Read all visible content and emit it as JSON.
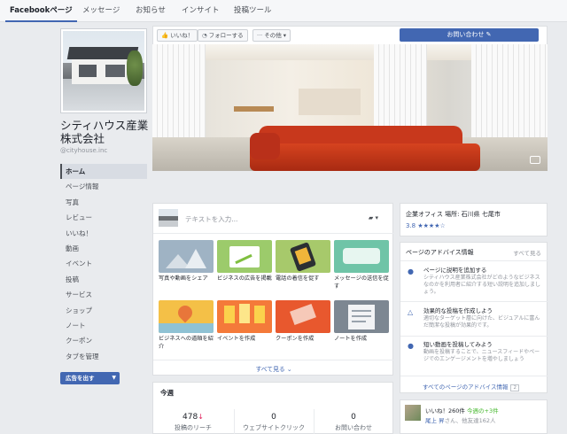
{
  "topbar": {
    "tabs": [
      "Facebookページ",
      "メッセージ",
      "お知らせ",
      "インサイト",
      "投稿ツール"
    ]
  },
  "page": {
    "name": "シティハウス産業株式会社",
    "handle": "@cityhouse.inc"
  },
  "leftnav": {
    "items": [
      "ホーム",
      "ページ情報",
      "写真",
      "レビュー",
      "いいね！",
      "動画",
      "イベント",
      "投稿",
      "サービス",
      "ショップ",
      "ノート",
      "クーポン",
      "タブを管理"
    ],
    "promote_label": "広告を出す"
  },
  "actions": {
    "like": "いいね！",
    "follow": "フォローする",
    "more": "その他",
    "contact": "お問い合わせ"
  },
  "composer": {
    "placeholder": "テキストを入力...",
    "tiles": [
      {
        "label": "写真や動画をシェア"
      },
      {
        "label": "ビジネスの広告を掲載"
      },
      {
        "label": "電話の着信を促す"
      },
      {
        "label": "メッセージの送信を促す"
      },
      {
        "label": "ビジネスへの道順を紹介"
      },
      {
        "label": "イベントを作成"
      },
      {
        "label": "クーポンを作成"
      },
      {
        "label": "ノートを作成"
      }
    ],
    "see_all": "すべて見る"
  },
  "week": {
    "title": "今週",
    "stats": [
      {
        "value": "478",
        "label": "投稿のリーチ",
        "trend": "↓"
      },
      {
        "value": "0",
        "label": "ウェブサイトクリック"
      },
      {
        "value": "0",
        "label": "お問い合わせ"
      }
    ]
  },
  "info": {
    "location": "企業オフィス 場所: 石川県 七尾市",
    "rating": "3.8",
    "stars": "★★★★☆"
  },
  "advice": {
    "title": "ページのアドバイス情報",
    "see_all": "すべて見る",
    "items": [
      {
        "title": "ページに説明を追加する",
        "text": "シティハウス産業株式会社がどのようなビジネスなのかを利用者に紹介する短い説明を追加しましょう。"
      },
      {
        "title": "効果的な投稿を作成しよう",
        "text": "適切なターゲット層に向けた、ビジュアルに富んだ簡潔な投稿が効果的です。"
      },
      {
        "title": "短い動画を投稿してみよう",
        "text": "動画を投稿することで、ニュースフィードやページでのエンゲージメントを増やしましょう"
      }
    ],
    "all_link": "すべてのページのアドバイス情報",
    "count": "2"
  },
  "likes": {
    "summary": "いいね！260件",
    "today": "今週の+3件",
    "friend": "尾上 昇",
    "others": "さん、他友達162人"
  }
}
